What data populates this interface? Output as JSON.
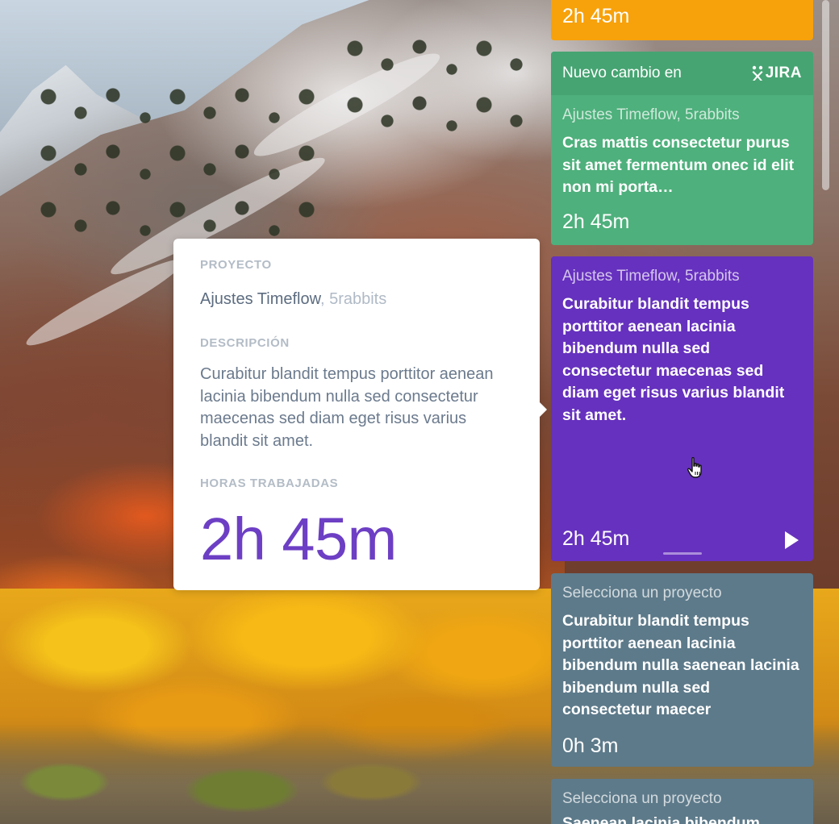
{
  "colors": {
    "orange_card": "#f7a10b",
    "green_card": "#4eb07c",
    "purple_card": "#6631be",
    "slate_card": "#5d7a8a",
    "hours_accent": "#6d3fc4"
  },
  "cards": {
    "orange": {
      "time": "2h 45m"
    },
    "green": {
      "header_text": "Nuevo cambio en",
      "integration_logo": "JIRA",
      "project": "Ajustes Timeflow, 5rabbits",
      "description": "Cras mattis consectetur purus sit amet fermentum onec id elit non mi porta…",
      "time": "2h 45m"
    },
    "purple": {
      "project": "Ajustes Timeflow, 5rabbits",
      "description": "Curabitur blandit tempus porttitor aenean lacinia bibendum nulla sed consectetur maecenas sed diam eget risus varius blandit sit amet.",
      "time": "2h 45m",
      "play_icon": "play-icon"
    },
    "slate": {
      "project": "Selecciona un proyecto",
      "description": "Curabitur blandit tempus porttitor aenean lacinia bibendum nulla saenean lacinia bibendum nulla sed consectetur maecer",
      "time": "0h 3m"
    },
    "slate2": {
      "project": "Selecciona un proyecto",
      "description": "Saenean lacinia bibendum"
    }
  },
  "popover": {
    "project_label": "PROYECTO",
    "project_name": "Ajustes Timeflow",
    "project_client": ", 5rabbits",
    "description_label": "DESCRIPCIÓN",
    "description": "Curabitur blandit tempus porttitor aenean lacinia bibendum nulla sed consectetur maecenas sed diam eget risus varius blandit sit amet.",
    "hours_label": "HORAS TRABAJADAS",
    "hours": "2h 45m"
  }
}
